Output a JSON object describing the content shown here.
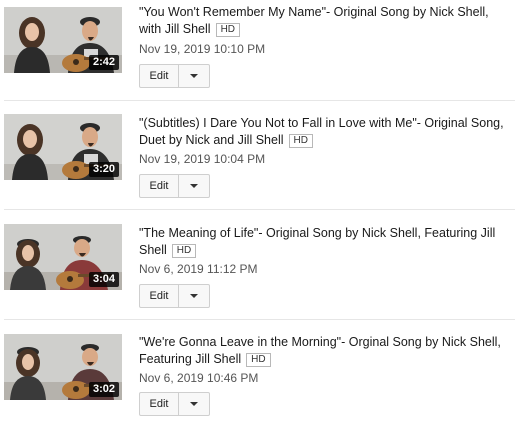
{
  "videos": [
    {
      "title": "\"You Won't Remember My Name\"- Original Song by Nick Shell, with Jill Shell",
      "badge": "HD",
      "date": "Nov 19, 2019 10:10 PM",
      "duration": "2:42",
      "edit_label": "Edit"
    },
    {
      "title": "\"(Subtitles) I Dare You Not to Fall in Love with Me\"- Original Song, Duet by Nick and Jill Shell",
      "badge": "HD",
      "date": "Nov 19, 2019 10:04 PM",
      "duration": "3:20",
      "edit_label": "Edit"
    },
    {
      "title": "\"The Meaning of Life\"- Original Song by Nick Shell, Featuring Jill Shell",
      "badge": "HD",
      "date": "Nov 6, 2019 11:12 PM",
      "duration": "3:04",
      "edit_label": "Edit"
    },
    {
      "title": "\"We're Gonna Leave in the Morning\"- Orginal Song by Nick Shell, Featuring Jill Shell",
      "badge": "HD",
      "date": "Nov 6, 2019 10:46 PM",
      "duration": "3:02",
      "edit_label": "Edit"
    }
  ],
  "colors": {
    "duration_bg": "#000000",
    "separator": "#e6e6e6",
    "button_bg": "#f8f8f8"
  },
  "icons": {
    "dropdown": "chevron-down-icon"
  }
}
